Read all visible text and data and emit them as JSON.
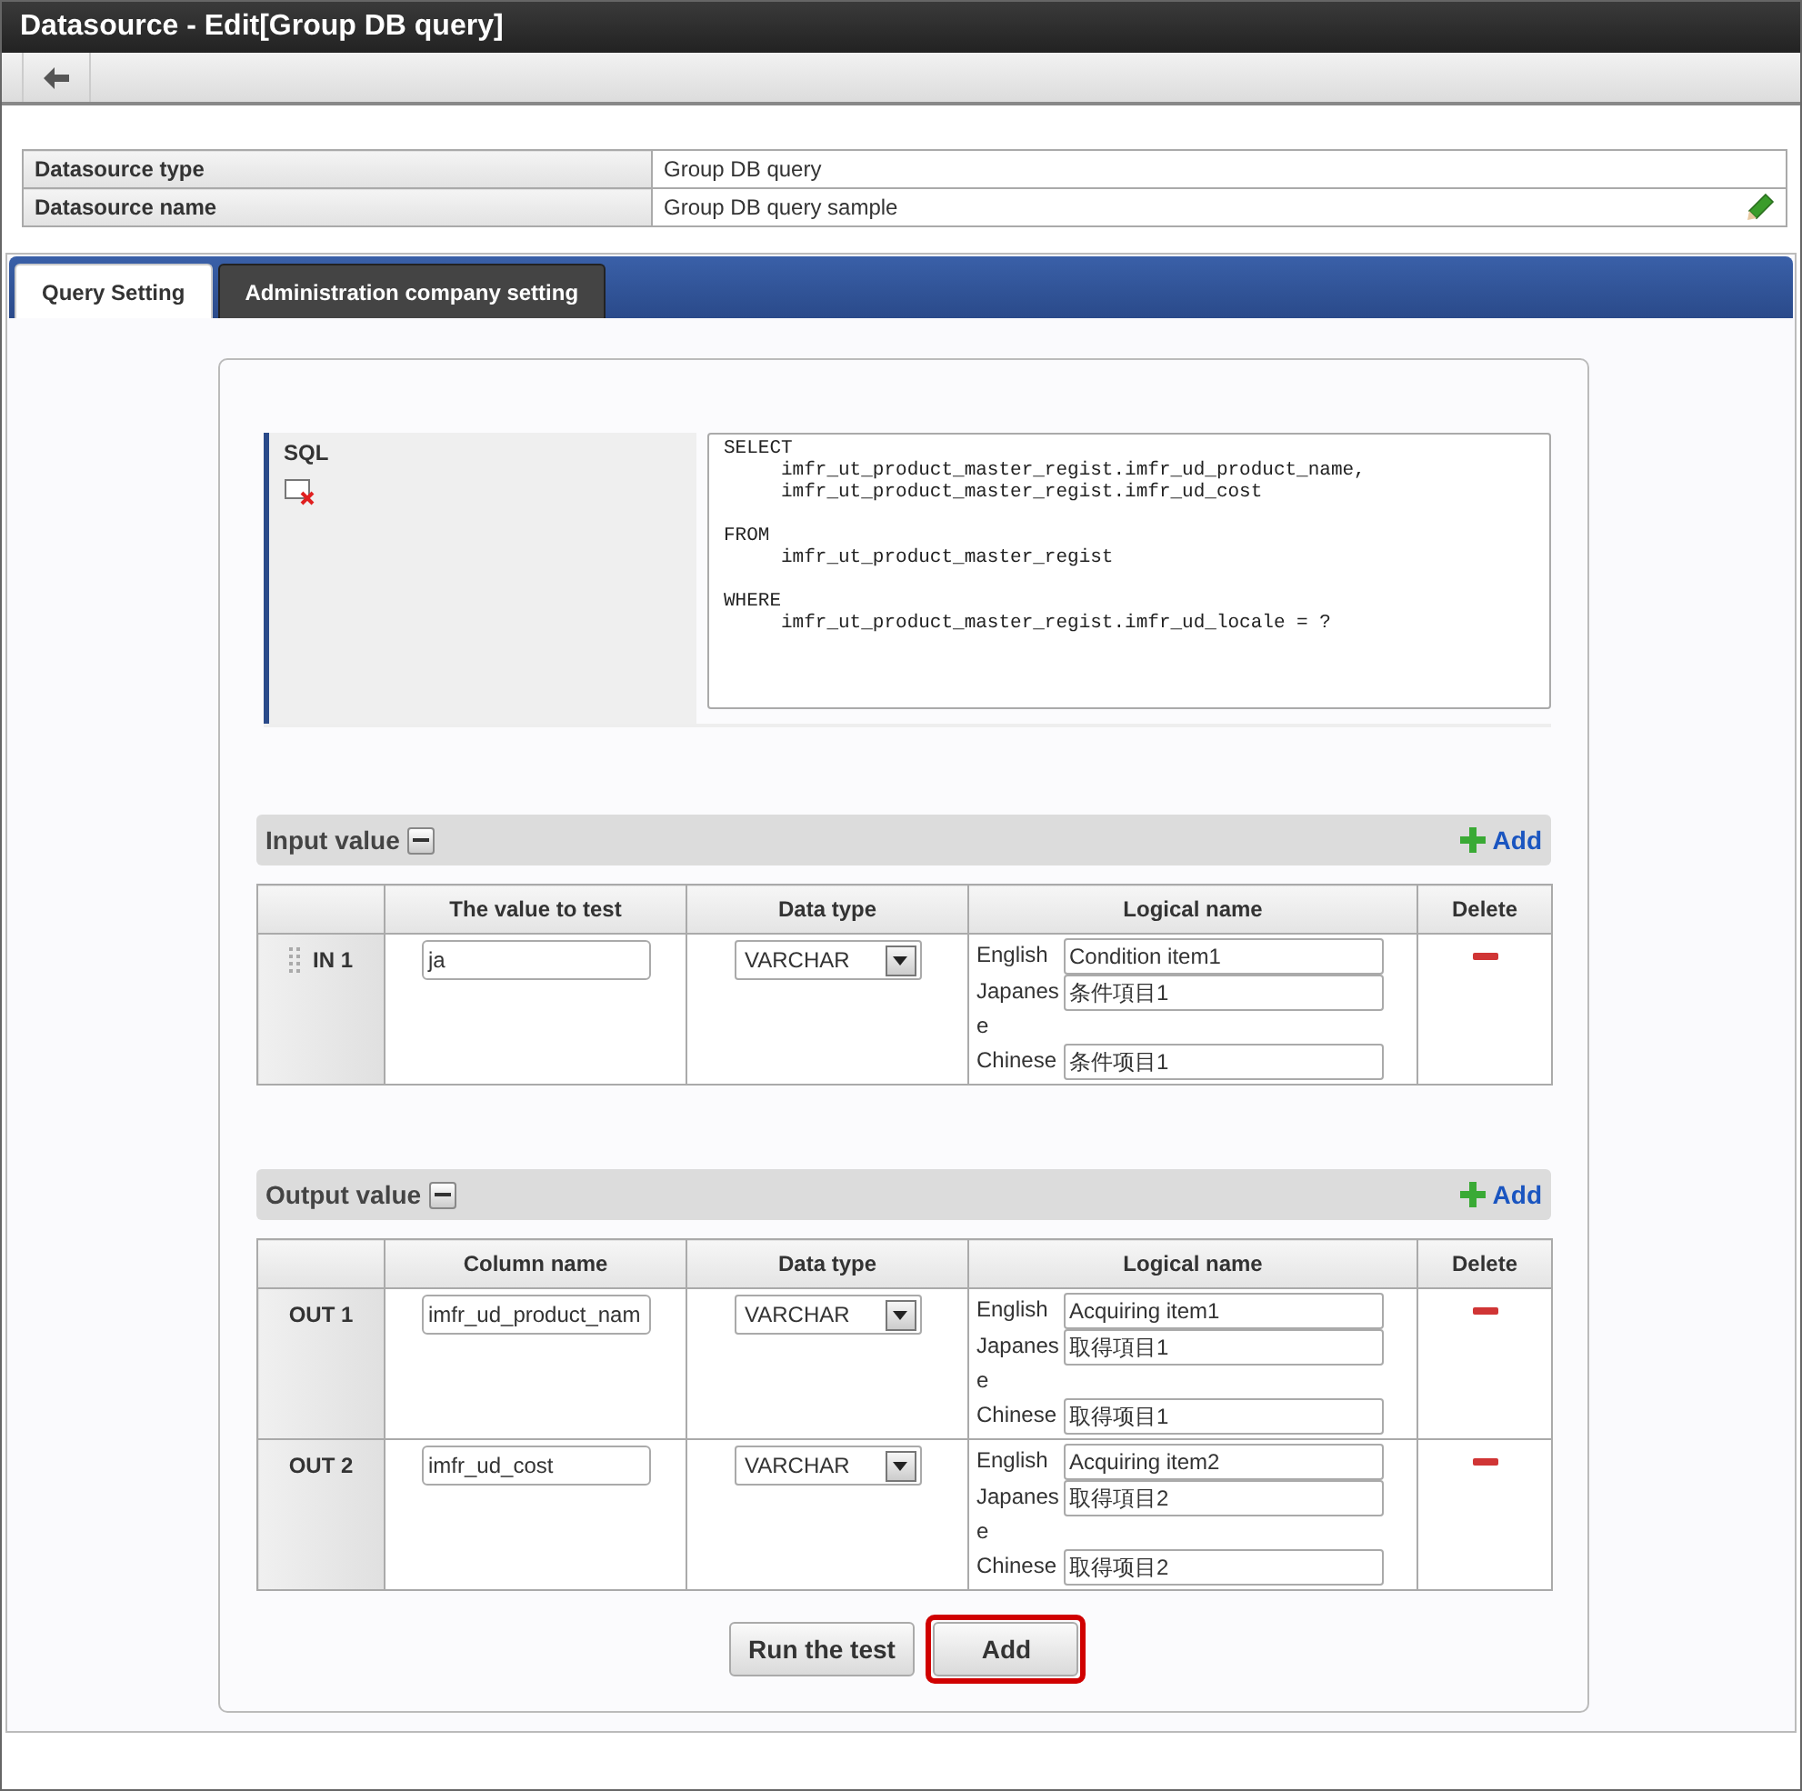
{
  "window": {
    "title": "Datasource - Edit[Group DB query]"
  },
  "info": [
    {
      "label": "Datasource type",
      "value": "Group DB query",
      "editable": false
    },
    {
      "label": "Datasource name",
      "value": "Group DB query sample",
      "editable": true
    }
  ],
  "tabs": [
    {
      "label": "Query Setting",
      "selected": true
    },
    {
      "label": "Administration company setting",
      "selected": false
    }
  ],
  "sql": {
    "label": "SQL",
    "text": "SELECT\n     imfr_ut_product_master_regist.imfr_ud_product_name,\n     imfr_ut_product_master_regist.imfr_ud_cost\n\nFROM\n     imfr_ut_product_master_regist\n\nWHERE\n     imfr_ut_product_master_regist.imfr_ud_locale = ?"
  },
  "sections": [
    {
      "title": "Input value",
      "add_label": "Add",
      "columns": [
        "",
        "The value to test",
        "Data type",
        "Logical name",
        "Delete"
      ],
      "rows": [
        {
          "label": "IN 1",
          "draggable": true,
          "value": "ja",
          "data_type": "VARCHAR",
          "logical": [
            {
              "lang": "English",
              "value": "Condition item1"
            },
            {
              "lang": "Japanese",
              "value": "条件項目1"
            },
            {
              "lang": "Chinese",
              "value": "条件项目1"
            }
          ]
        }
      ]
    },
    {
      "title": "Output value",
      "add_label": "Add",
      "columns": [
        "",
        "Column name",
        "Data type",
        "Logical name",
        "Delete"
      ],
      "rows": [
        {
          "label": "OUT 1",
          "draggable": false,
          "value": "imfr_ud_product_nam",
          "data_type": "VARCHAR",
          "logical": [
            {
              "lang": "English",
              "value": "Acquiring item1"
            },
            {
              "lang": "Japanese",
              "value": "取得項目1"
            },
            {
              "lang": "Chinese",
              "value": "取得项目1"
            }
          ]
        },
        {
          "label": "OUT 2",
          "draggable": false,
          "value": "imfr_ud_cost",
          "data_type": "VARCHAR",
          "logical": [
            {
              "lang": "English",
              "value": "Acquiring item2"
            },
            {
              "lang": "Japanese",
              "value": "取得項目2"
            },
            {
              "lang": "Chinese",
              "value": "取得项目2"
            }
          ]
        }
      ]
    }
  ],
  "buttons": [
    {
      "label": "Run the test",
      "highlighted": false
    },
    {
      "label": "Add",
      "highlighted": true
    }
  ]
}
